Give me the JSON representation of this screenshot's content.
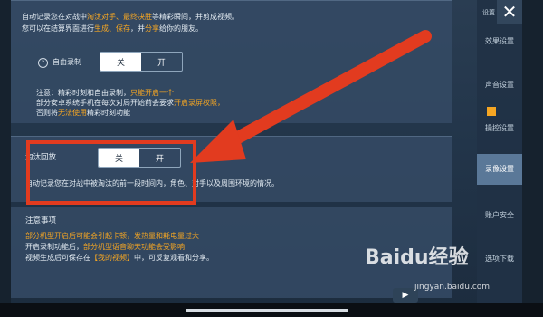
{
  "panel1": {
    "line1": [
      "自动记录您在对战中",
      "淘汰对手、最终决胜",
      "等精彩瞬间，并剪成视频。"
    ],
    "line2": [
      "您可以在结算界面进行",
      "生成、保存",
      "，并",
      "分享",
      "给你的朋友。"
    ],
    "auto_record_label": "自由录制",
    "help_mark": "?",
    "toggle_off": "关",
    "toggle_on": "开",
    "note1": [
      "注意：精彩时刻和自由录制，",
      "只能开启一个"
    ],
    "note2": [
      "部分安卓系统手机在每次对局开始前会要求",
      "开启录屏权限，"
    ],
    "note3": [
      "否则将",
      "无法使用",
      "精彩时刻功能"
    ]
  },
  "panel2": {
    "label": "淘汰回放",
    "toggle_off": "关",
    "toggle_on": "开",
    "desc": "自动记录您在对战中被淘汰的前一段时间内，角色、对手以及周围环境的情况。"
  },
  "panel3": {
    "title": "注意事项",
    "line1": "部分机型开启后可能会引起卡顿，发热量和耗电量过大",
    "line2": [
      "开启录制功能后，",
      "部分机型语音聊天功能会受影响"
    ],
    "line3": [
      "视频生成后可保存在",
      "【我的视频】",
      "中，可反复观看和分享。"
    ]
  },
  "sidebar": {
    "top_label": "设置",
    "close": "✕",
    "items": [
      "效果设置",
      "声音设置",
      "操控设置",
      "录像设置",
      "账户安全",
      "选项下载"
    ]
  },
  "watermark": {
    "brand": "Baidu经验",
    "url": "jingyan.baidu.com"
  },
  "bottom_button_label": "▶ ",
  "colors": {
    "highlight": "#f5a623",
    "annotation_red": "#e23b1f",
    "panel": "#34496a"
  }
}
